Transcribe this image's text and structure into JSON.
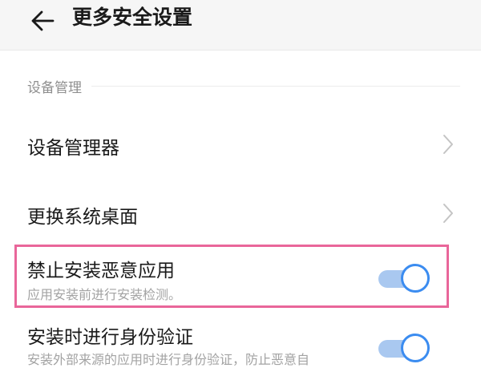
{
  "header": {
    "back_icon": "arrow-left-icon",
    "title": "更多安全设置"
  },
  "section": {
    "title": "设备管理"
  },
  "rows": [
    {
      "title": "设备管理器",
      "icon": "chevron-right-icon"
    },
    {
      "title": "更换系统桌面",
      "icon": "chevron-right-icon"
    },
    {
      "title": "禁止安装恶意应用",
      "subtitle": "应用安装前进行安装检测。",
      "toggle_on": true,
      "highlighted": true
    },
    {
      "title": "安装时进行身份验证",
      "subtitle": "安装外部来源的应用时进行身份验证，防止恶意自",
      "toggle_on": true
    }
  ],
  "colors": {
    "toggle_accent": "#3b8cf0",
    "toggle_track": "#a9c8f0",
    "highlight_border": "#e9669a"
  }
}
